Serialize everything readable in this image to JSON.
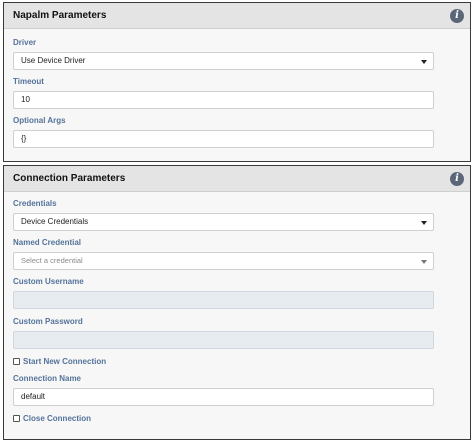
{
  "napalm": {
    "title": "Napalm Parameters",
    "driver_label": "Driver",
    "driver_value": "Use Device Driver",
    "timeout_label": "Timeout",
    "timeout_value": "10",
    "optional_args_label": "Optional Args",
    "optional_args_value": "{}"
  },
  "connection": {
    "title": "Connection Parameters",
    "credentials_label": "Credentials",
    "credentials_value": "Device Credentials",
    "named_credential_label": "Named Credential",
    "named_credential_placeholder": "Select a credential",
    "custom_username_label": "Custom Username",
    "custom_username_value": "",
    "custom_password_label": "Custom Password",
    "custom_password_value": "",
    "start_new_connection_label": "Start New Connection",
    "start_new_connection_checked": false,
    "connection_name_label": "Connection Name",
    "connection_name_value": "default",
    "close_connection_label": "Close Connection",
    "close_connection_checked": false
  },
  "icons": {
    "info": "info-icon",
    "caret": "chevron-down-icon"
  },
  "colors": {
    "label_blue": "#54739a",
    "header_bg": "#e4e4e4",
    "info_icon_bg": "#5b6778",
    "disabled_field_bg": "#e7ecf1"
  }
}
